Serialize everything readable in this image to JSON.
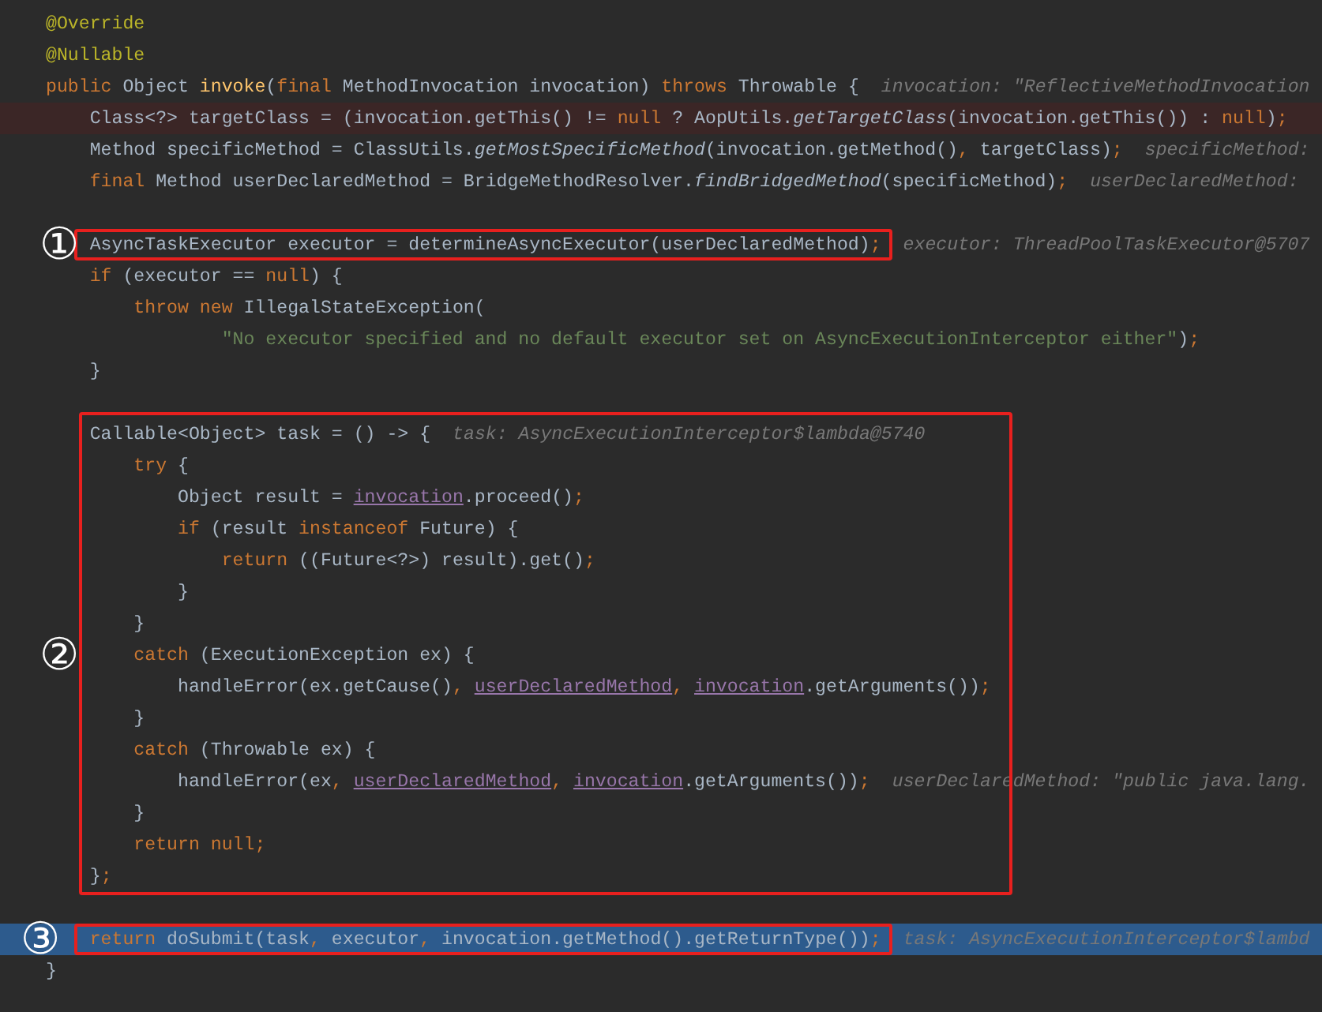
{
  "editor": {
    "sections": [
      {
        "lines": [
          {
            "kind": "code",
            "tokens": [
              {
                "kind": "annotation",
                "text": "@Override"
              }
            ]
          },
          {
            "kind": "code",
            "tokens": [
              {
                "kind": "annotation",
                "text": "@Nullable"
              }
            ]
          },
          {
            "kind": "code",
            "tokens": [
              {
                "kind": "keyword",
                "text": "public"
              },
              {
                "kind": "plain",
                "text": " Object "
              },
              {
                "kind": "declaration",
                "text": "invoke"
              },
              {
                "kind": "plain",
                "text": "("
              },
              {
                "kind": "keyword",
                "text": "final"
              },
              {
                "kind": "plain",
                "text": " MethodInvocation invocation) "
              },
              {
                "kind": "keyword",
                "text": "throws"
              },
              {
                "kind": "plain",
                "text": " Throwable {"
              }
            ],
            "hint": "invocation: \"ReflectiveMethodInvocation"
          },
          {
            "kind": "breakpoint_line",
            "tokens": [
              {
                "kind": "plain",
                "text": "    Class<?> targetClass = (invocation.getThis() != "
              },
              {
                "kind": "keyword",
                "text": "null"
              },
              {
                "kind": "plain",
                "text": " ? AopUtils."
              },
              {
                "kind": "static_call",
                "text": "getTargetClass"
              },
              {
                "kind": "plain",
                "text": "(invocation.getThis()) : "
              },
              {
                "kind": "keyword",
                "text": "null"
              },
              {
                "kind": "plain",
                "text": ")"
              },
              {
                "kind": "punctuation",
                "text": ";"
              }
            ]
          },
          {
            "kind": "code",
            "tokens": [
              {
                "kind": "plain",
                "text": "    Method specificMethod = ClassUtils."
              },
              {
                "kind": "static_call",
                "text": "getMostSpecificMethod"
              },
              {
                "kind": "plain",
                "text": "(invocation.getMethod()"
              },
              {
                "kind": "punctuation",
                "text": ","
              },
              {
                "kind": "plain",
                "text": " targetClass)"
              },
              {
                "kind": "punctuation",
                "text": ";"
              }
            ],
            "hint": "specificMethod:"
          },
          {
            "kind": "code",
            "tokens": [
              {
                "kind": "keyword",
                "text": "    final"
              },
              {
                "kind": "plain",
                "text": " Method userDeclaredMethod = BridgeMethodResolver."
              },
              {
                "kind": "static_call",
                "text": "findBridgedMethod"
              },
              {
                "kind": "plain",
                "text": "(specificMethod)"
              },
              {
                "kind": "punctuation",
                "text": ";"
              }
            ],
            "hint": "userDeclaredMethod:"
          },
          {
            "kind": "blank"
          }
        ]
      },
      {
        "marker": "①",
        "lines": [
          {
            "kind": "code",
            "tokens": [
              {
                "kind": "plain",
                "text": "    AsyncTaskExecutor executor = determineAsyncExecutor(userDeclaredMethod)"
              },
              {
                "kind": "punctuation",
                "text": ";"
              }
            ],
            "hint": "executor: ThreadPoolTaskExecutor@5707"
          }
        ]
      },
      {
        "lines": [
          {
            "kind": "code",
            "tokens": [
              {
                "kind": "keyword",
                "text": "    if"
              },
              {
                "kind": "plain",
                "text": " (executor == "
              },
              {
                "kind": "keyword",
                "text": "null"
              },
              {
                "kind": "plain",
                "text": ") {"
              }
            ]
          },
          {
            "kind": "code",
            "tokens": [
              {
                "kind": "keyword",
                "text": "        throw new"
              },
              {
                "kind": "plain",
                "text": " IllegalStateException("
              }
            ]
          },
          {
            "kind": "code",
            "tokens": [
              {
                "kind": "string",
                "text": "                \"No executor specified and no default executor set on AsyncExecutionInterceptor either\""
              },
              {
                "kind": "plain",
                "text": ")"
              },
              {
                "kind": "punctuation",
                "text": ";"
              }
            ]
          },
          {
            "kind": "code",
            "tokens": [
              {
                "kind": "plain",
                "text": "    }"
              }
            ]
          },
          {
            "kind": "blank"
          }
        ]
      },
      {
        "marker": "②",
        "lines": [
          {
            "kind": "code",
            "tokens": [
              {
                "kind": "plain",
                "text": "    Callable<Object> task = () -> {"
              }
            ],
            "hint": "task: AsyncExecutionInterceptor$lambda@5740"
          },
          {
            "kind": "code",
            "tokens": [
              {
                "kind": "keyword",
                "text": "        try"
              },
              {
                "kind": "plain",
                "text": " {"
              }
            ]
          },
          {
            "kind": "code",
            "tokens": [
              {
                "kind": "plain",
                "text": "            Object result = "
              },
              {
                "kind": "field_ref",
                "text": "invocation"
              },
              {
                "kind": "plain",
                "text": ".proceed()"
              },
              {
                "kind": "punctuation",
                "text": ";"
              }
            ]
          },
          {
            "kind": "code",
            "tokens": [
              {
                "kind": "keyword",
                "text": "            if"
              },
              {
                "kind": "plain",
                "text": " (result "
              },
              {
                "kind": "keyword",
                "text": "instanceof"
              },
              {
                "kind": "plain",
                "text": " Future) {"
              }
            ]
          },
          {
            "kind": "code",
            "tokens": [
              {
                "kind": "keyword",
                "text": "                return"
              },
              {
                "kind": "plain",
                "text": " ((Future<?>) result).get()"
              },
              {
                "kind": "punctuation",
                "text": ";"
              }
            ]
          },
          {
            "kind": "code",
            "tokens": [
              {
                "kind": "plain",
                "text": "            }"
              }
            ]
          },
          {
            "kind": "code",
            "tokens": [
              {
                "kind": "plain",
                "text": "        }"
              }
            ]
          },
          {
            "kind": "code",
            "tokens": [
              {
                "kind": "keyword",
                "text": "        catch"
              },
              {
                "kind": "plain",
                "text": " (ExecutionException ex) {"
              }
            ]
          },
          {
            "kind": "code",
            "tokens": [
              {
                "kind": "plain",
                "text": "            handleError(ex.getCause()"
              },
              {
                "kind": "punctuation",
                "text": ", "
              },
              {
                "kind": "field_ref",
                "text": "userDeclaredMethod"
              },
              {
                "kind": "punctuation",
                "text": ", "
              },
              {
                "kind": "field_ref",
                "text": "invocation"
              },
              {
                "kind": "plain",
                "text": ".getArguments())"
              },
              {
                "kind": "punctuation",
                "text": ";"
              }
            ]
          },
          {
            "kind": "code",
            "tokens": [
              {
                "kind": "plain",
                "text": "        }"
              }
            ]
          },
          {
            "kind": "code",
            "tokens": [
              {
                "kind": "keyword",
                "text": "        catch"
              },
              {
                "kind": "plain",
                "text": " (Throwable ex) {"
              }
            ]
          },
          {
            "kind": "code",
            "tokens": [
              {
                "kind": "plain",
                "text": "            handleError(ex"
              },
              {
                "kind": "punctuation",
                "text": ", "
              },
              {
                "kind": "field_ref",
                "text": "userDeclaredMethod"
              },
              {
                "kind": "punctuation",
                "text": ", "
              },
              {
                "kind": "field_ref",
                "text": "invocation"
              },
              {
                "kind": "plain",
                "text": ".getArguments())"
              },
              {
                "kind": "punctuation",
                "text": ";"
              }
            ],
            "hint": "userDeclaredMethod: \"public java.lang."
          },
          {
            "kind": "code",
            "tokens": [
              {
                "kind": "plain",
                "text": "        }"
              }
            ]
          },
          {
            "kind": "code",
            "tokens": [
              {
                "kind": "keyword",
                "text": "        return null"
              },
              {
                "kind": "punctuation",
                "text": ";"
              }
            ]
          },
          {
            "kind": "code",
            "tokens": [
              {
                "kind": "plain",
                "text": "    }"
              },
              {
                "kind": "punctuation",
                "text": ";"
              }
            ]
          }
        ]
      },
      {
        "lines": [
          {
            "kind": "blank"
          }
        ]
      },
      {
        "marker": "③",
        "lines": [
          {
            "kind": "execution_line",
            "tokens": [
              {
                "kind": "keyword",
                "text": "    return"
              },
              {
                "kind": "plain",
                "text": " doSubmit(task"
              },
              {
                "kind": "punctuation",
                "text": ","
              },
              {
                "kind": "plain",
                "text": " executor"
              },
              {
                "kind": "punctuation",
                "text": ","
              },
              {
                "kind": "plain",
                "text": " invocation.getMethod().getReturnType())"
              },
              {
                "kind": "punctuation",
                "text": ";"
              }
            ],
            "hint": "task: AsyncExecutionInterceptor$lambd"
          }
        ]
      },
      {
        "lines": [
          {
            "kind": "code",
            "tokens": [
              {
                "kind": "plain",
                "text": "}"
              }
            ]
          }
        ]
      }
    ]
  }
}
